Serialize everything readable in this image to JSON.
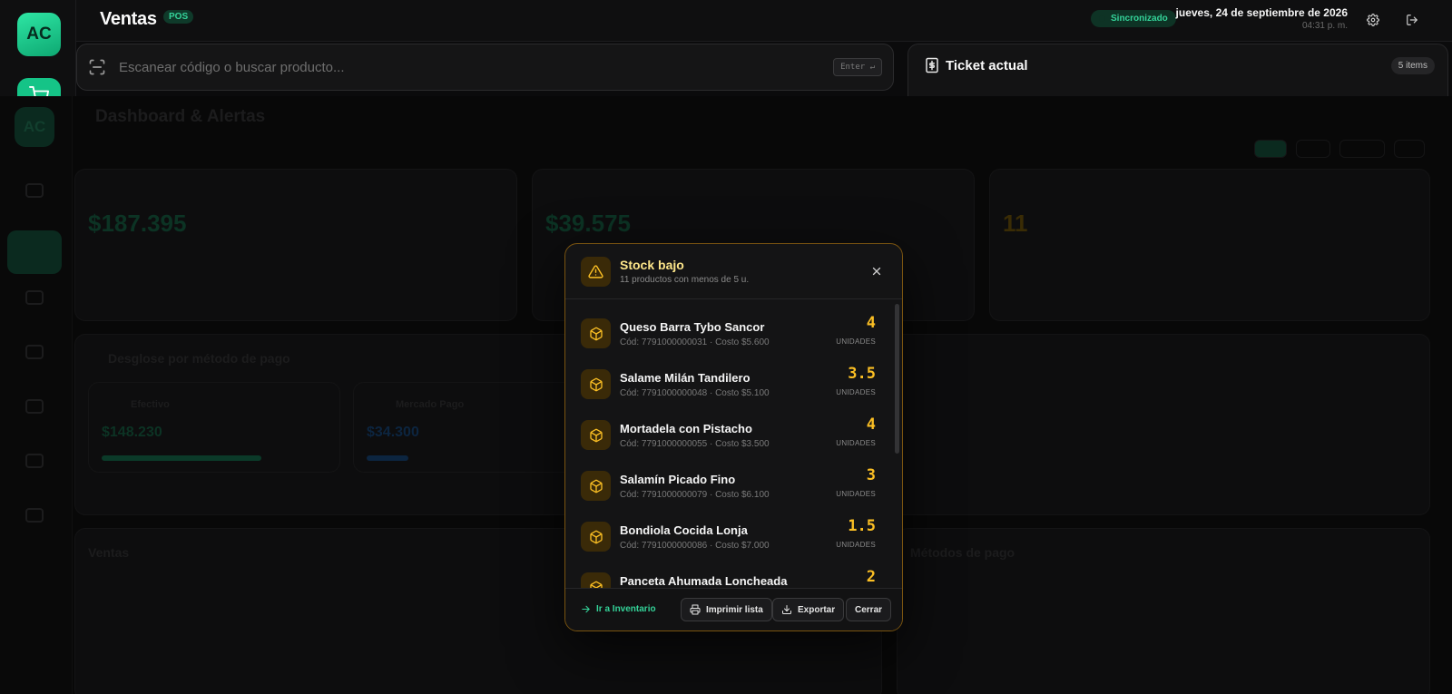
{
  "sidebar": {
    "logo": "AC"
  },
  "header": {
    "title": "Ventas",
    "badge": "POS",
    "sync_status": "Sincronizado",
    "date": "jueves, 24 de septiembre de 2026",
    "time": "04:31 p. m."
  },
  "search": {
    "placeholder": "Escanear código o buscar producto...",
    "enter_hint": "Enter ↵"
  },
  "ticket": {
    "title": "Ticket actual",
    "count": "5 items"
  },
  "background_dashboard": {
    "title": "Dashboard & Alertas",
    "kpi_income_value": "$187.395",
    "kpi_profit_value": "$39.575",
    "kpi_stock_value": "11",
    "payment_title": "Desglose por método de pago",
    "payment_cash_label": "Efectivo",
    "payment_cash_value": "$148.230",
    "payment_mp_label": "Mercado Pago",
    "payment_mp_value": "$34.300",
    "sales_title": "Ventas",
    "methods_title": "Métodos de pago"
  },
  "modal": {
    "title": "Stock bajo",
    "subtitle": "11 productos con menos de 5 u.",
    "unit_label": "UNIDADES",
    "items": [
      {
        "name": "Queso Barra Tybo Sancor",
        "meta": "Cód: 7791000000031 · Costo $5.600",
        "qty": "4"
      },
      {
        "name": "Salame Milán Tandilero",
        "meta": "Cód: 7791000000048 · Costo $5.100",
        "qty": "3.5"
      },
      {
        "name": "Mortadela con Pistacho",
        "meta": "Cód: 7791000000055 · Costo $3.500",
        "qty": "4"
      },
      {
        "name": "Salamín Picado Fino",
        "meta": "Cód: 7791000000079 · Costo $6.100",
        "qty": "3"
      },
      {
        "name": "Bondiola Cocida Lonja",
        "meta": "Cód: 7791000000086 · Costo $7.000",
        "qty": "1.5"
      },
      {
        "name": "Panceta Ahumada Loncheada",
        "meta": "",
        "qty": "2"
      }
    ],
    "footer": {
      "go_inventory": "Ir a Inventario",
      "print": "Imprimir lista",
      "export": "Exportar",
      "close": "Cerrar"
    }
  },
  "colors": {
    "accent_green": "#34d399",
    "warning_amber": "#fbbf24",
    "modal_border": "#7a5410"
  }
}
